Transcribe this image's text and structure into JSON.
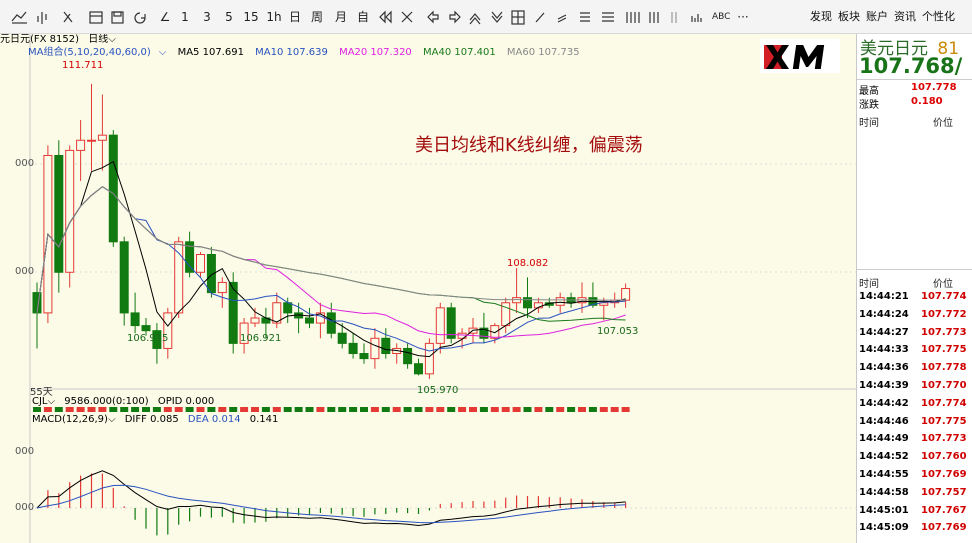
{
  "toolbar": {
    "buttons": [
      "1",
      "3",
      "5",
      "15",
      "1h",
      "日",
      "周",
      "月",
      "自"
    ],
    "abc": "ABC",
    "more": "···",
    "right_menu": [
      "发现",
      "板块",
      "账户",
      "资讯",
      "个性化"
    ]
  },
  "chart": {
    "symbol": "元日元(FX 8152)",
    "period": "日线",
    "ma_group": "MA组合(5,10,20,40,60,0)",
    "ma": [
      {
        "label": "MA5 107.691",
        "color": "#000000"
      },
      {
        "label": "MA10 107.639",
        "color": "#2a52be"
      },
      {
        "label": "MA20 107.320",
        "color": "#e020e0"
      },
      {
        "label": "MA40 107.401",
        "color": "#1a7a1a"
      },
      {
        "label": "MA60 107.735",
        "color": "#888888"
      }
    ],
    "overlay_text": "美日均线和K线纠缠，偏震荡",
    "annotations": {
      "high": "111.711",
      "low1": "106.915",
      "low2": "106.921",
      "low3": "105.970",
      "high2": "108.082",
      "low4": "107.053"
    },
    "y_labels": [
      "000",
      "000"
    ],
    "period_tag": "55天",
    "cjl": {
      "label": "CJL",
      "v1": "9586.000(0:100)",
      "v2": "OPID 0.000"
    },
    "macd": {
      "label": "MACD(12,26,9)",
      "diff": "DIFF 0.085",
      "dea": "DEA 0.014",
      "val": "0.141"
    },
    "macd_y_labels": [
      "000",
      "000"
    ]
  },
  "chart_data": {
    "type": "candlestick",
    "candles": [
      [
        107.6,
        107.8,
        106.5,
        107.2
      ],
      [
        107.2,
        110.5,
        107.0,
        110.3
      ],
      [
        110.3,
        110.6,
        107.6,
        108.0
      ],
      [
        108.0,
        110.5,
        107.7,
        110.4
      ],
      [
        110.4,
        111.0,
        109.8,
        110.6
      ],
      [
        110.6,
        111.711,
        110.0,
        110.6
      ],
      [
        110.6,
        111.5,
        110.0,
        110.7
      ],
      [
        110.7,
        110.8,
        108.5,
        108.6
      ],
      [
        108.6,
        108.7,
        106.95,
        107.2
      ],
      [
        107.2,
        107.6,
        106.8,
        106.95
      ],
      [
        106.95,
        107.1,
        106.75,
        106.85
      ],
      [
        106.85,
        107.0,
        106.2,
        106.5
      ],
      [
        106.5,
        107.3,
        106.3,
        107.2
      ],
      [
        107.2,
        108.7,
        107.1,
        108.6
      ],
      [
        108.6,
        108.8,
        107.9,
        108.0
      ],
      [
        108.0,
        108.4,
        107.9,
        108.35
      ],
      [
        108.35,
        108.5,
        107.5,
        107.6
      ],
      [
        107.6,
        107.9,
        107.3,
        107.8
      ],
      [
        107.8,
        108.0,
        106.4,
        106.6
      ],
      [
        106.6,
        107.1,
        106.4,
        107.0
      ],
      [
        107.0,
        107.3,
        106.921,
        107.1
      ],
      [
        107.1,
        107.3,
        106.7,
        107.0
      ],
      [
        107.0,
        107.6,
        106.9,
        107.4
      ],
      [
        107.4,
        107.5,
        107.0,
        107.2
      ],
      [
        107.2,
        107.4,
        106.8,
        107.1
      ],
      [
        107.1,
        107.3,
        106.9,
        107.0
      ],
      [
        107.0,
        107.4,
        106.7,
        107.2
      ],
      [
        107.2,
        107.4,
        106.7,
        106.8
      ],
      [
        106.8,
        107.0,
        106.5,
        106.6
      ],
      [
        106.6,
        106.8,
        106.3,
        106.4
      ],
      [
        106.4,
        106.6,
        106.2,
        106.3
      ],
      [
        106.3,
        106.9,
        106.1,
        106.7
      ],
      [
        106.7,
        106.9,
        106.3,
        106.4
      ],
      [
        106.4,
        106.6,
        106.2,
        106.5
      ],
      [
        106.5,
        106.6,
        106.1,
        106.2
      ],
      [
        106.2,
        106.3,
        105.97,
        106.0
      ],
      [
        106.0,
        106.7,
        105.9,
        106.6
      ],
      [
        106.6,
        107.4,
        106.4,
        107.3
      ],
      [
        107.3,
        107.4,
        106.6,
        106.7
      ],
      [
        106.7,
        106.9,
        106.5,
        106.8
      ],
      [
        106.8,
        107.1,
        106.6,
        106.9
      ],
      [
        106.9,
        107.2,
        106.6,
        106.7
      ],
      [
        106.7,
        107.0,
        106.6,
        106.95
      ],
      [
        106.95,
        107.5,
        106.8,
        107.4
      ],
      [
        107.4,
        108.082,
        107.2,
        107.5
      ],
      [
        107.5,
        107.9,
        107.1,
        107.3
      ],
      [
        107.3,
        107.5,
        107.2,
        107.4
      ],
      [
        107.4,
        107.5,
        107.3,
        107.35
      ],
      [
        107.35,
        107.6,
        107.2,
        107.5
      ],
      [
        107.5,
        107.6,
        107.3,
        107.4
      ],
      [
        107.4,
        107.8,
        107.2,
        107.5
      ],
      [
        107.5,
        107.8,
        107.3,
        107.35
      ],
      [
        107.35,
        107.5,
        107.053,
        107.4
      ],
      [
        107.4,
        107.6,
        107.3,
        107.45
      ],
      [
        107.45,
        107.78,
        107.3,
        107.68
      ]
    ],
    "y_range": [
      105.8,
      112.2
    ]
  },
  "right_panel": {
    "title": "美元日元",
    "title_code": "81",
    "last_price": "107.768",
    "last_suffix": "/",
    "rows": [
      {
        "label": "最高",
        "value": "107.778"
      },
      {
        "label": "涨跌",
        "value": "0.180"
      }
    ],
    "col_time": "时间",
    "col_price": "价位",
    "ticks": [
      {
        "t": "14:44:21",
        "p": "107.774"
      },
      {
        "t": "14:44:24",
        "p": "107.772"
      },
      {
        "t": "14:44:27",
        "p": "107.773"
      },
      {
        "t": "14:44:33",
        "p": "107.775"
      },
      {
        "t": "14:44:36",
        "p": "107.778"
      },
      {
        "t": "14:44:39",
        "p": "107.770"
      },
      {
        "t": "14:44:42",
        "p": "107.774"
      },
      {
        "t": "14:44:46",
        "p": "107.775"
      },
      {
        "t": "14:44:49",
        "p": "107.773"
      },
      {
        "t": "14:44:52",
        "p": "107.760"
      },
      {
        "t": "14:44:55",
        "p": "107.769"
      },
      {
        "t": "14:44:58",
        "p": "107.757"
      },
      {
        "t": "14:45:01",
        "p": "107.767"
      },
      {
        "t": "14:45:09",
        "p": "107.769"
      }
    ]
  },
  "logo": {
    "text": "XM"
  }
}
